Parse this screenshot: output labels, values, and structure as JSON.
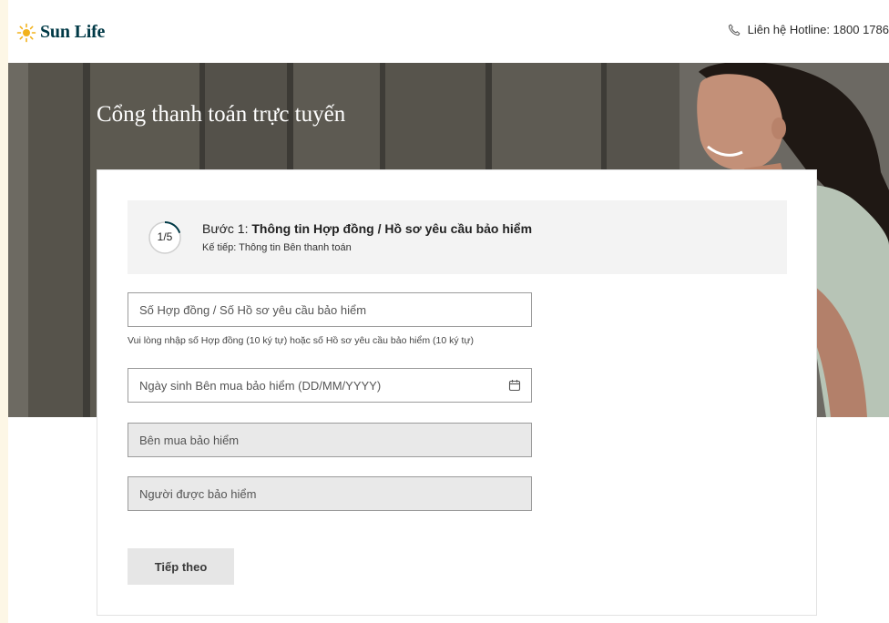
{
  "header": {
    "logo_text": "Sun Life",
    "hotline_text": "Liên hệ Hotline: 1800 1786"
  },
  "hero": {
    "title": "Cổng thanh toán trực tuyến"
  },
  "step": {
    "indicator": "1/5",
    "prefix": "Bước 1: ",
    "title": "Thông tin Hợp đồng / Hồ sơ yêu cầu bảo hiểm",
    "next": "Kế tiếp: Thông tin Bên thanh toán",
    "progress_fraction": 0.2
  },
  "form": {
    "policy_number_placeholder": "Số Hợp đồng / Số Hồ sơ yêu cầu bảo hiểm",
    "policy_number_hint": "Vui lòng nhập số Hợp đồng (10 ký tự) hoặc số Hồ sơ yêu cầu bảo hiểm (10 ký tự)",
    "dob_placeholder": "Ngày sinh Bên mua bảo hiểm (DD/MM/YYYY)",
    "policyholder_placeholder": "Bên mua bảo hiểm",
    "insured_placeholder": "Người được bảo hiểm",
    "next_button": "Tiếp theo"
  },
  "colors": {
    "brand_navy": "#003946",
    "brand_gold": "#f2b21c",
    "page_background": "#fdf7e6"
  },
  "icons": [
    "sun-logo-icon",
    "phone-icon",
    "calendar-icon"
  ]
}
